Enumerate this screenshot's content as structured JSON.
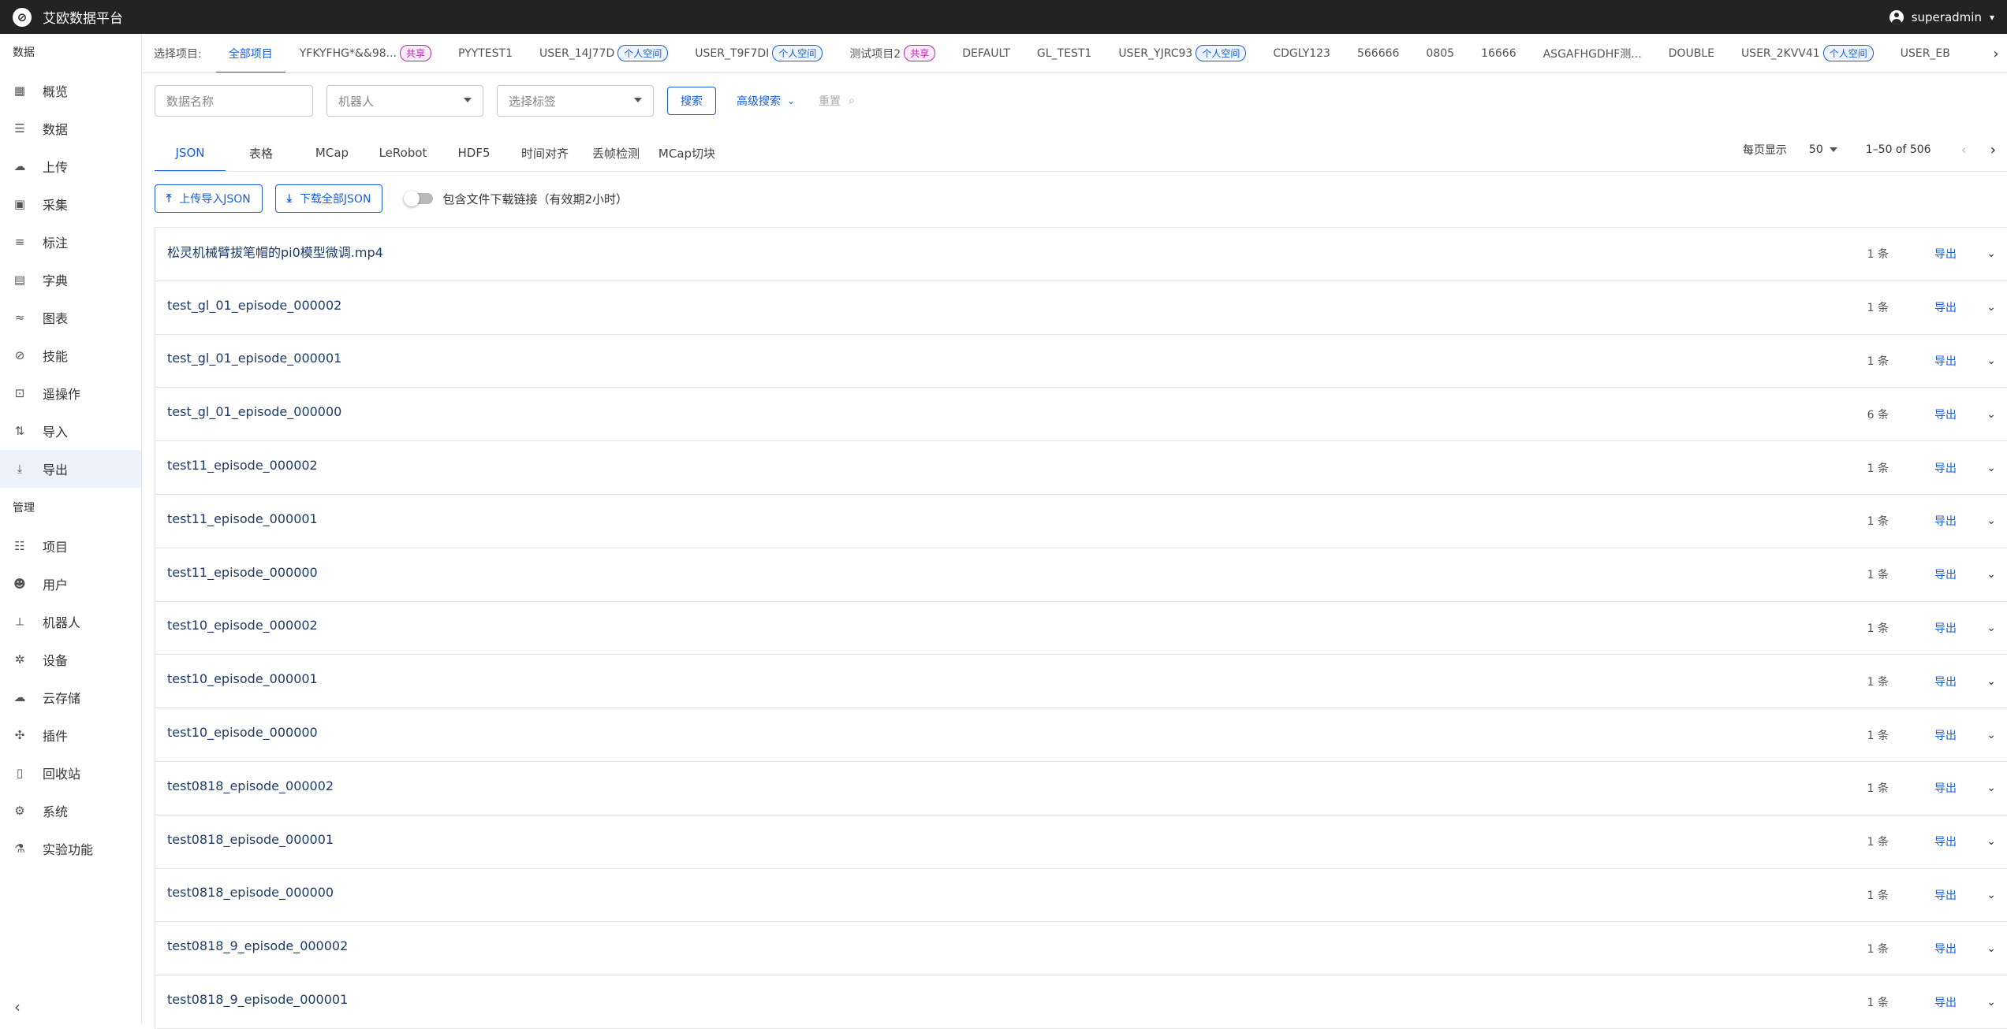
{
  "app": {
    "title": "艾欧数据平台",
    "user": "superadmin"
  },
  "sidebar": {
    "section_data": "数据",
    "data_items": [
      {
        "label": "概览",
        "icon": "dashboard-icon"
      },
      {
        "label": "数据",
        "icon": "list-icon"
      },
      {
        "label": "上传",
        "icon": "cloud-upload-icon"
      },
      {
        "label": "采集",
        "icon": "video-icon"
      },
      {
        "label": "标注",
        "icon": "annotation-icon"
      },
      {
        "label": "字典",
        "icon": "book-icon"
      },
      {
        "label": "图表",
        "icon": "chart-icon"
      },
      {
        "label": "技能",
        "icon": "skill-icon"
      },
      {
        "label": "遥操作",
        "icon": "gamepad-icon"
      },
      {
        "label": "导入",
        "icon": "import-icon"
      },
      {
        "label": "导出",
        "icon": "download-icon"
      }
    ],
    "section_manage": "管理",
    "manage_items": [
      {
        "label": "项目",
        "icon": "project-icon"
      },
      {
        "label": "用户",
        "icon": "users-icon"
      },
      {
        "label": "机器人",
        "icon": "robot-arm-icon"
      },
      {
        "label": "设备",
        "icon": "device-icon"
      },
      {
        "label": "云存储",
        "icon": "cloud-icon"
      },
      {
        "label": "插件",
        "icon": "plugin-icon"
      },
      {
        "label": "回收站",
        "icon": "trash-icon"
      },
      {
        "label": "系统",
        "icon": "gear-icon"
      },
      {
        "label": "实验功能",
        "icon": "flask-icon"
      }
    ]
  },
  "projects": {
    "label": "选择项目:",
    "items": [
      {
        "name": "全部项目",
        "badge": ""
      },
      {
        "name": "YFKYFHG*&&98...",
        "badge": "共享"
      },
      {
        "name": "PYYTEST1",
        "badge": ""
      },
      {
        "name": "USER_14J77D",
        "badge": "个人空间"
      },
      {
        "name": "USER_T9F7DI",
        "badge": "个人空间"
      },
      {
        "name": "测试项目2",
        "badge": "共享"
      },
      {
        "name": "DEFAULT",
        "badge": ""
      },
      {
        "name": "GL_TEST1",
        "badge": ""
      },
      {
        "name": "USER_YJRC93",
        "badge": "个人空间"
      },
      {
        "name": "CDGLY123",
        "badge": ""
      },
      {
        "name": "566666",
        "badge": ""
      },
      {
        "name": "0805",
        "badge": ""
      },
      {
        "name": "16666",
        "badge": ""
      },
      {
        "name": "ASGAFHGDHF测...",
        "badge": ""
      },
      {
        "name": "DOUBLE",
        "badge": ""
      },
      {
        "name": "USER_2KVV41",
        "badge": "个人空间"
      },
      {
        "name": "USER_EB",
        "badge": ""
      }
    ]
  },
  "filters": {
    "name_placeholder": "数据名称",
    "robot_placeholder": "机器人",
    "tag_placeholder": "选择标签",
    "search_label": "搜索",
    "advanced_label": "高级搜索",
    "reset_label": "重置"
  },
  "tabs": [
    "JSON",
    "表格",
    "MCap",
    "LeRobot",
    "HDF5",
    "时间对齐",
    "丢帧检测",
    "MCap切块"
  ],
  "pager": {
    "per_page_label": "每页显示",
    "per_page": "50",
    "range": "1–50 of 506"
  },
  "actions": {
    "upload_label": "上传导入JSON",
    "download_label": "下载全部JSON",
    "toggle_label": "包含文件下载链接（有效期2小时）"
  },
  "rows": [
    {
      "name": "松灵机械臂拔笔帽的pi0模型微调.mp4",
      "count": "1 条",
      "export": "导出"
    },
    {
      "name": "test_gl_01_episode_000002",
      "count": "1 条",
      "export": "导出"
    },
    {
      "name": "test_gl_01_episode_000001",
      "count": "1 条",
      "export": "导出"
    },
    {
      "name": "test_gl_01_episode_000000",
      "count": "6 条",
      "export": "导出"
    },
    {
      "name": "test11_episode_000002",
      "count": "1 条",
      "export": "导出"
    },
    {
      "name": "test11_episode_000001",
      "count": "1 条",
      "export": "导出"
    },
    {
      "name": "test11_episode_000000",
      "count": "1 条",
      "export": "导出"
    },
    {
      "name": "test10_episode_000002",
      "count": "1 条",
      "export": "导出"
    },
    {
      "name": "test10_episode_000001",
      "count": "1 条",
      "export": "导出"
    },
    {
      "name": "test10_episode_000000",
      "count": "1 条",
      "export": "导出"
    },
    {
      "name": "test0818_episode_000002",
      "count": "1 条",
      "export": "导出"
    },
    {
      "name": "test0818_episode_000001",
      "count": "1 条",
      "export": "导出"
    },
    {
      "name": "test0818_episode_000000",
      "count": "1 条",
      "export": "导出"
    },
    {
      "name": "test0818_9_episode_000002",
      "count": "1 条",
      "export": "导出"
    },
    {
      "name": "test0818_9_episode_000001",
      "count": "1 条",
      "export": "导出"
    }
  ],
  "colors": {
    "accent": "#1a5fd8",
    "topbar": "#232323",
    "active_bg": "#edf3fd",
    "share": "#b02ca5"
  }
}
